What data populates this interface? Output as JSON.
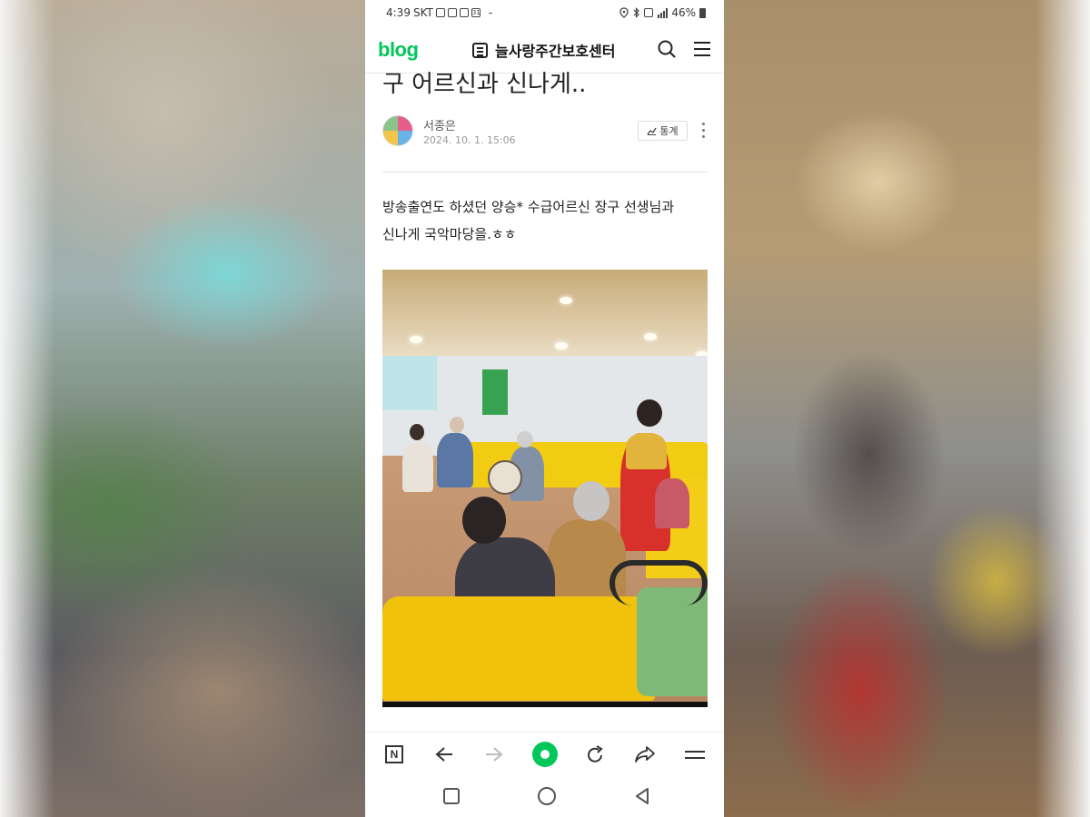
{
  "status_bar": {
    "time": "4:39",
    "carrier": "SKT",
    "battery": "46%"
  },
  "header": {
    "logo": "blog",
    "blog_name": "늘사랑주간보호센터"
  },
  "post": {
    "title_partial": "구 어르신과 신나게..",
    "author": "서종은",
    "date": "2024. 10. 1. 15:06",
    "stats_label": "통계",
    "body_line1": "방송출연도 하셨던 양승* 수급어르신 장구 선생님과",
    "body_line2": "신나게 국악마당을.ㅎㅎ"
  },
  "colors": {
    "brand_green": "#03c75a"
  },
  "icons": {
    "header": [
      "list-icon",
      "search-icon",
      "menu-icon"
    ],
    "browser_bar": [
      "naver-n-icon",
      "back-arrow-icon",
      "forward-arrow-icon",
      "green-home-icon",
      "refresh-icon",
      "share-icon",
      "hamburger-icon"
    ],
    "nav_bar": [
      "recent-apps-icon",
      "home-icon",
      "back-icon"
    ]
  }
}
